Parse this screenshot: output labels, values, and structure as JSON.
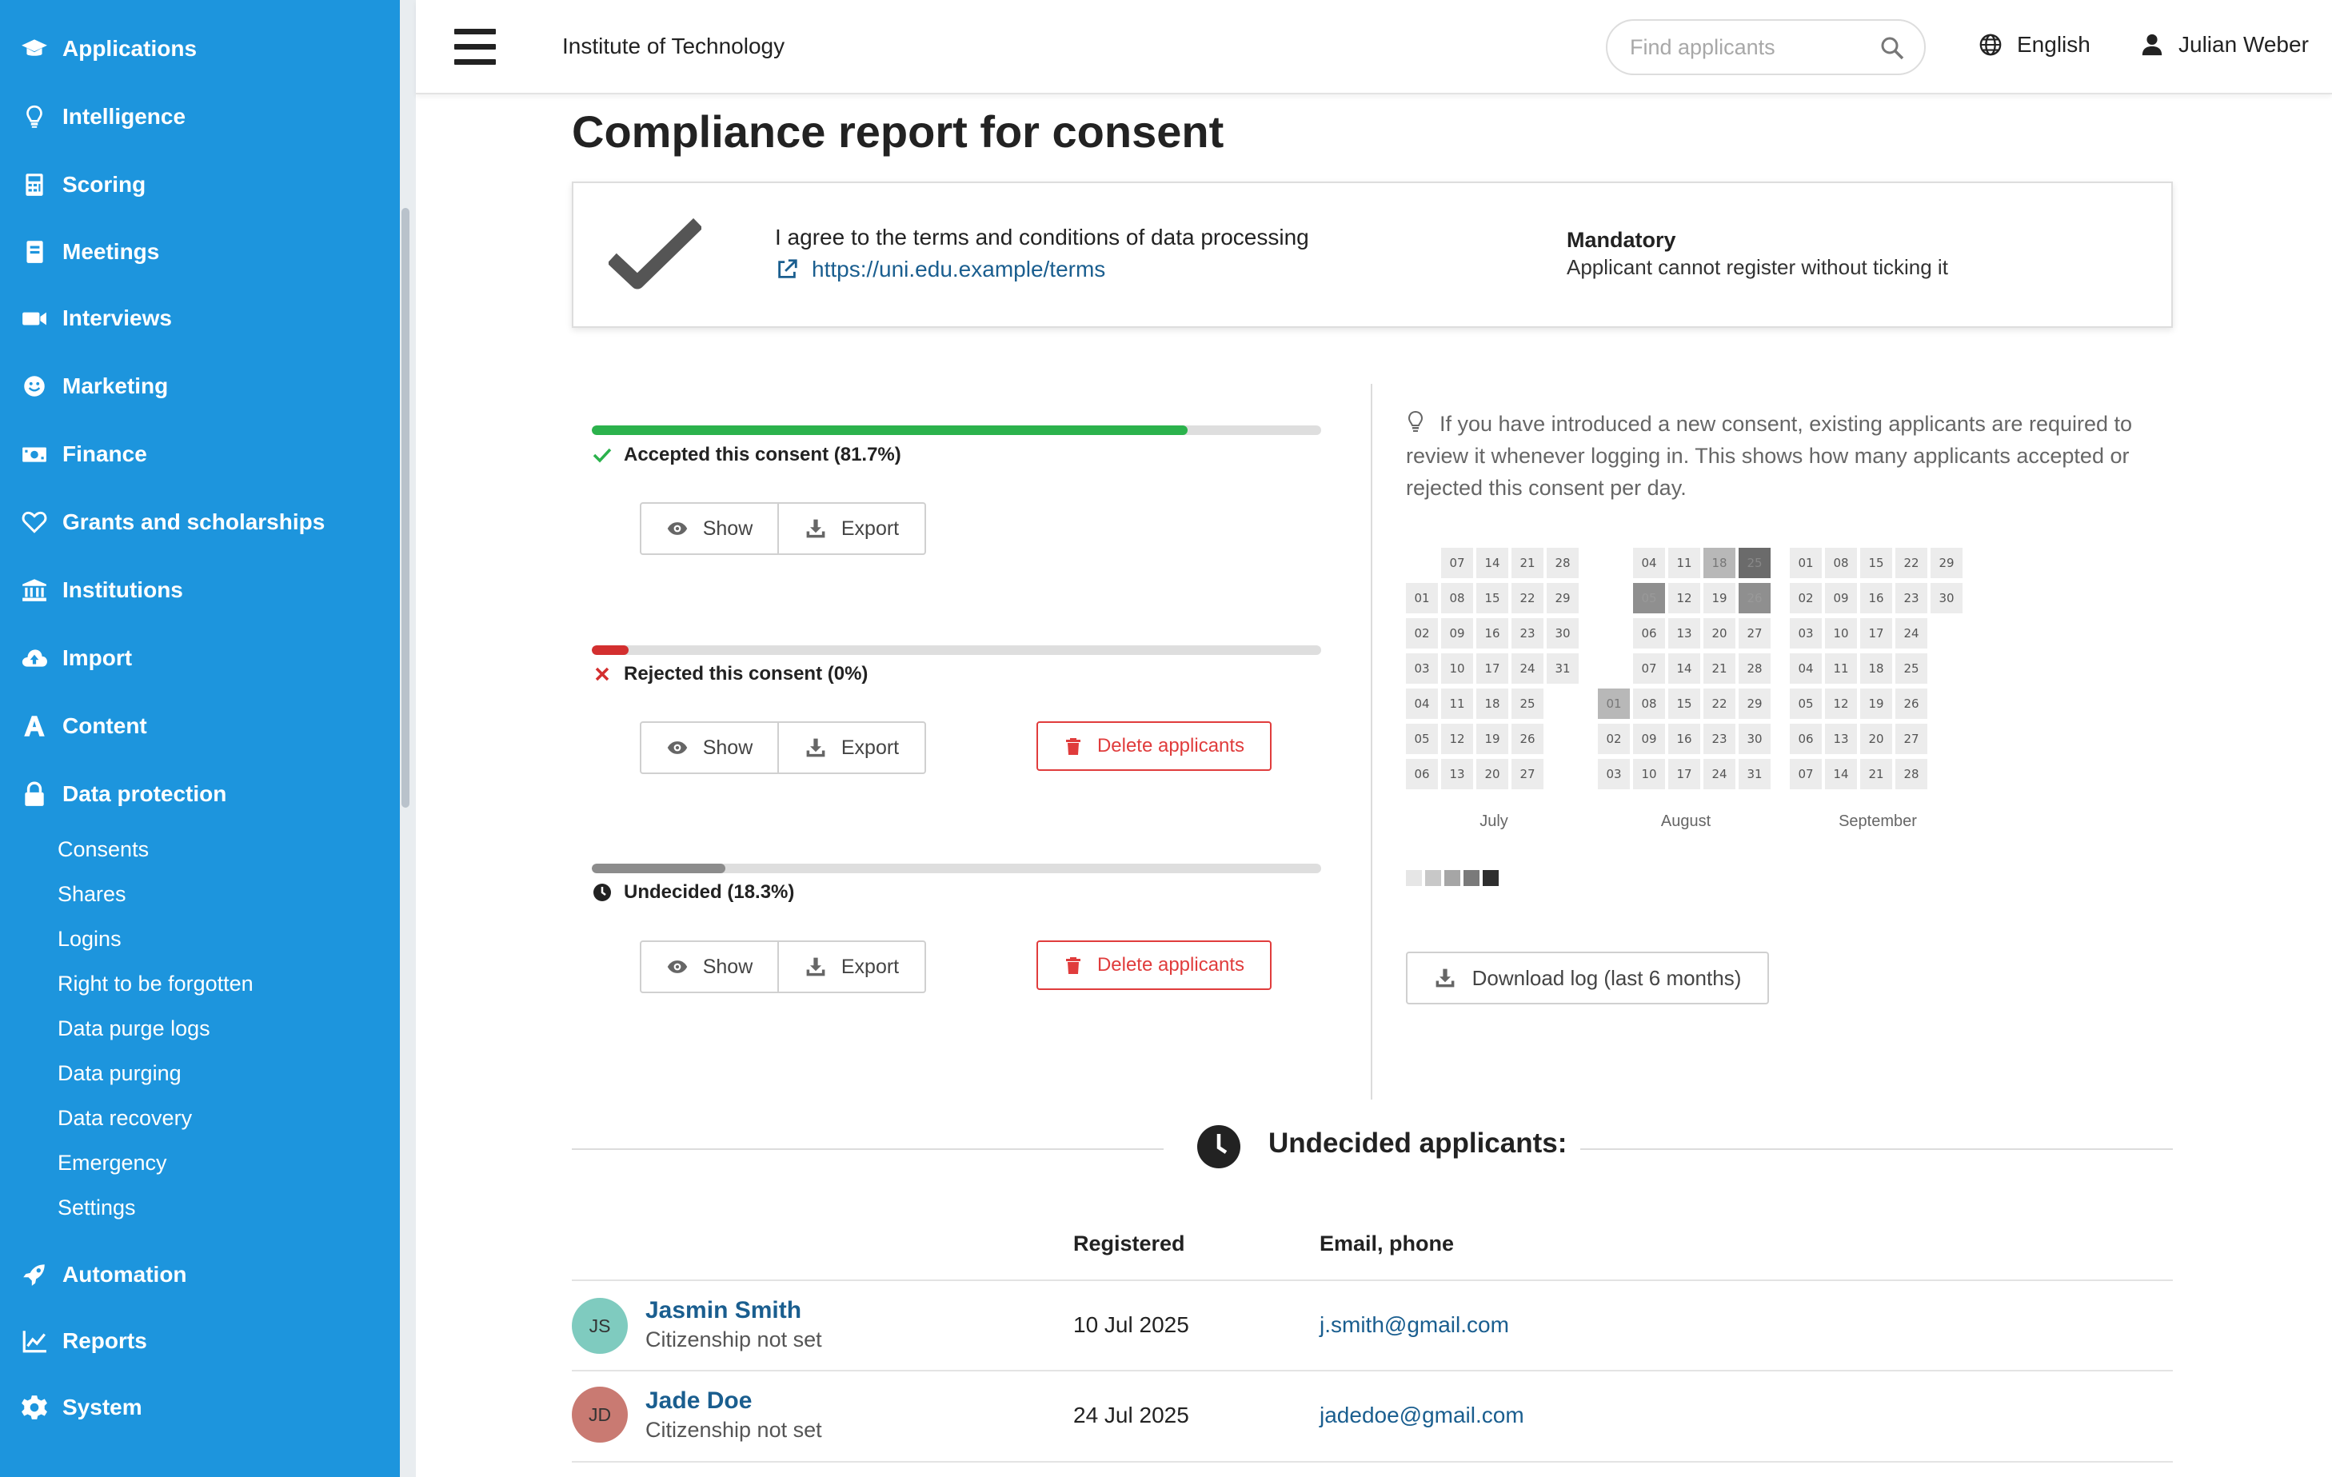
{
  "colors": {
    "sidebar_bg": "#1d95dd",
    "link": "#1a5e8f",
    "accepted": "#2bb24c",
    "rejected": "#d32f2f",
    "undecided": "#8c8c8c",
    "danger": "#e03c3c"
  },
  "sidebar": {
    "items": [
      {
        "label": "Applications",
        "icon": "graduation-cap-icon"
      },
      {
        "label": "Intelligence",
        "icon": "lightbulb-icon"
      },
      {
        "label": "Scoring",
        "icon": "calculator-icon"
      },
      {
        "label": "Meetings",
        "icon": "calendar-book-icon"
      },
      {
        "label": "Interviews",
        "icon": "video-camera-icon"
      },
      {
        "label": "Marketing",
        "icon": "smiley-icon"
      },
      {
        "label": "Finance",
        "icon": "money-bill-icon"
      },
      {
        "label": "Grants and scholarships",
        "icon": "heart-icon"
      },
      {
        "label": "Institutions",
        "icon": "bank-icon"
      },
      {
        "label": "Import",
        "icon": "cloud-upload-icon"
      },
      {
        "label": "Content",
        "icon": "letter-a-icon"
      },
      {
        "label": "Data protection",
        "icon": "lock-icon"
      }
    ],
    "sub_items": [
      "Consents",
      "Shares",
      "Logins",
      "Right to be forgotten",
      "Data purge logs",
      "Data purging",
      "Data recovery",
      "Emergency",
      "Settings"
    ],
    "bottom_items": [
      {
        "label": "Automation",
        "icon": "rocket-icon"
      },
      {
        "label": "Reports",
        "icon": "line-chart-icon"
      },
      {
        "label": "System",
        "icon": "gear-icon"
      }
    ]
  },
  "header": {
    "org_name": "Institute of Technology",
    "search_placeholder": "Find applicants",
    "language": "English",
    "user_name": "Julian Weber"
  },
  "page": {
    "title": "Compliance report for consent"
  },
  "consent": {
    "text": "I agree to the terms and conditions of data processing",
    "link": "https://uni.edu.example/terms",
    "mandatory_title": "Mandatory",
    "mandatory_desc": "Applicant cannot register without ticking it"
  },
  "stats": [
    {
      "label": "Accepted this consent (81.7%)",
      "percent": 81.7,
      "status": "accepted",
      "show_label": "Show",
      "export_label": "Export",
      "delete_label": null
    },
    {
      "label": "Rejected this consent (0%)",
      "percent": 0,
      "status": "rejected",
      "show_label": "Show",
      "export_label": "Export",
      "delete_label": "Delete applicants"
    },
    {
      "label": "Undecided (18.3%)",
      "percent": 18.3,
      "status": "undecided",
      "show_label": "Show",
      "export_label": "Export",
      "delete_label": "Delete applicants"
    }
  ],
  "hint": "If you have introduced a new consent, existing applicants are required to review it whenever logging in. This shows how many applicants accepted or rejected this consent per day.",
  "calendar": {
    "months": [
      {
        "name": "July",
        "days": 31,
        "first_weekday": 1,
        "levels": {}
      },
      {
        "name": "August",
        "days": 31,
        "first_weekday": 4,
        "levels": {
          "1": 2,
          "5": 3,
          "18": 2,
          "25": 4,
          "26": 3
        }
      },
      {
        "name": "September",
        "days": 30,
        "first_weekday": 0,
        "levels": {}
      }
    ],
    "legend_levels": [
      "#e6e6e6",
      "#c8c8c8",
      "#a6a6a6",
      "#7a7a7a",
      "#2e2e2e"
    ]
  },
  "download_label": "Download log (last 6 months)",
  "undecided_section": {
    "title": "Undecided applicants:",
    "columns": {
      "registered": "Registered",
      "contact": "Email, phone"
    },
    "rows": [
      {
        "initials": "JS",
        "name": "Jasmin Smith",
        "citizenship": "Citizenship not set",
        "registered": "10 Jul 2025",
        "email": "j.smith@gmail.com",
        "avatar_color": "#7fcbbf"
      },
      {
        "initials": "JD",
        "name": "Jade Doe",
        "citizenship": "Citizenship not set",
        "registered": "24 Jul 2025",
        "email": "jadedoe@gmail.com",
        "avatar_color": "#c97a72"
      }
    ]
  }
}
